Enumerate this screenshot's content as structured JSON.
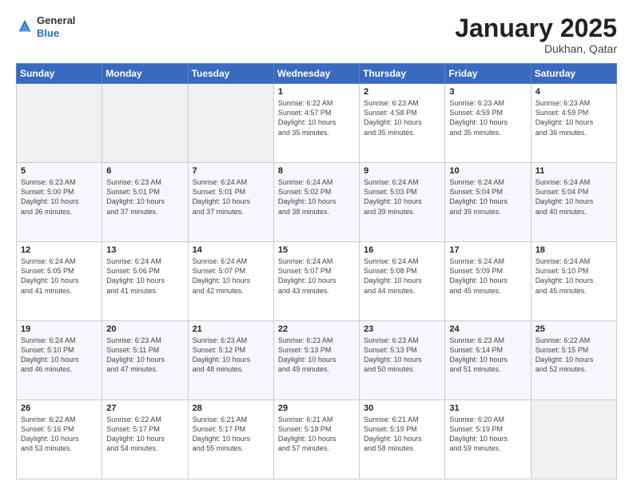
{
  "header": {
    "logo_general": "General",
    "logo_blue": "Blue",
    "month_title": "January 2025",
    "subtitle": "Dukhan, Qatar"
  },
  "days_of_week": [
    "Sunday",
    "Monday",
    "Tuesday",
    "Wednesday",
    "Thursday",
    "Friday",
    "Saturday"
  ],
  "weeks": [
    [
      {
        "num": "",
        "info": ""
      },
      {
        "num": "",
        "info": ""
      },
      {
        "num": "",
        "info": ""
      },
      {
        "num": "1",
        "info": "Sunrise: 6:22 AM\nSunset: 4:57 PM\nDaylight: 10 hours\nand 35 minutes."
      },
      {
        "num": "2",
        "info": "Sunrise: 6:23 AM\nSunset: 4:58 PM\nDaylight: 10 hours\nand 35 minutes."
      },
      {
        "num": "3",
        "info": "Sunrise: 6:23 AM\nSunset: 4:59 PM\nDaylight: 10 hours\nand 35 minutes."
      },
      {
        "num": "4",
        "info": "Sunrise: 6:23 AM\nSunset: 4:59 PM\nDaylight: 10 hours\nand 36 minutes."
      }
    ],
    [
      {
        "num": "5",
        "info": "Sunrise: 6:23 AM\nSunset: 5:00 PM\nDaylight: 10 hours\nand 36 minutes."
      },
      {
        "num": "6",
        "info": "Sunrise: 6:23 AM\nSunset: 5:01 PM\nDaylight: 10 hours\nand 37 minutes."
      },
      {
        "num": "7",
        "info": "Sunrise: 6:24 AM\nSunset: 5:01 PM\nDaylight: 10 hours\nand 37 minutes."
      },
      {
        "num": "8",
        "info": "Sunrise: 6:24 AM\nSunset: 5:02 PM\nDaylight: 10 hours\nand 38 minutes."
      },
      {
        "num": "9",
        "info": "Sunrise: 6:24 AM\nSunset: 5:03 PM\nDaylight: 10 hours\nand 39 minutes."
      },
      {
        "num": "10",
        "info": "Sunrise: 6:24 AM\nSunset: 5:04 PM\nDaylight: 10 hours\nand 39 minutes."
      },
      {
        "num": "11",
        "info": "Sunrise: 6:24 AM\nSunset: 5:04 PM\nDaylight: 10 hours\nand 40 minutes."
      }
    ],
    [
      {
        "num": "12",
        "info": "Sunrise: 6:24 AM\nSunset: 5:05 PM\nDaylight: 10 hours\nand 41 minutes."
      },
      {
        "num": "13",
        "info": "Sunrise: 6:24 AM\nSunset: 5:06 PM\nDaylight: 10 hours\nand 41 minutes."
      },
      {
        "num": "14",
        "info": "Sunrise: 6:24 AM\nSunset: 5:07 PM\nDaylight: 10 hours\nand 42 minutes."
      },
      {
        "num": "15",
        "info": "Sunrise: 6:24 AM\nSunset: 5:07 PM\nDaylight: 10 hours\nand 43 minutes."
      },
      {
        "num": "16",
        "info": "Sunrise: 6:24 AM\nSunset: 5:08 PM\nDaylight: 10 hours\nand 44 minutes."
      },
      {
        "num": "17",
        "info": "Sunrise: 6:24 AM\nSunset: 5:09 PM\nDaylight: 10 hours\nand 45 minutes."
      },
      {
        "num": "18",
        "info": "Sunrise: 6:24 AM\nSunset: 5:10 PM\nDaylight: 10 hours\nand 45 minutes."
      }
    ],
    [
      {
        "num": "19",
        "info": "Sunrise: 6:24 AM\nSunset: 5:10 PM\nDaylight: 10 hours\nand 46 minutes."
      },
      {
        "num": "20",
        "info": "Sunrise: 6:23 AM\nSunset: 5:11 PM\nDaylight: 10 hours\nand 47 minutes."
      },
      {
        "num": "21",
        "info": "Sunrise: 6:23 AM\nSunset: 5:12 PM\nDaylight: 10 hours\nand 48 minutes."
      },
      {
        "num": "22",
        "info": "Sunrise: 6:23 AM\nSunset: 5:13 PM\nDaylight: 10 hours\nand 49 minutes."
      },
      {
        "num": "23",
        "info": "Sunrise: 6:23 AM\nSunset: 5:13 PM\nDaylight: 10 hours\nand 50 minutes."
      },
      {
        "num": "24",
        "info": "Sunrise: 6:23 AM\nSunset: 5:14 PM\nDaylight: 10 hours\nand 51 minutes."
      },
      {
        "num": "25",
        "info": "Sunrise: 6:22 AM\nSunset: 5:15 PM\nDaylight: 10 hours\nand 52 minutes."
      }
    ],
    [
      {
        "num": "26",
        "info": "Sunrise: 6:22 AM\nSunset: 5:16 PM\nDaylight: 10 hours\nand 53 minutes."
      },
      {
        "num": "27",
        "info": "Sunrise: 6:22 AM\nSunset: 5:17 PM\nDaylight: 10 hours\nand 54 minutes."
      },
      {
        "num": "28",
        "info": "Sunrise: 6:21 AM\nSunset: 5:17 PM\nDaylight: 10 hours\nand 55 minutes."
      },
      {
        "num": "29",
        "info": "Sunrise: 6:21 AM\nSunset: 5:18 PM\nDaylight: 10 hours\nand 57 minutes."
      },
      {
        "num": "30",
        "info": "Sunrise: 6:21 AM\nSunset: 5:19 PM\nDaylight: 10 hours\nand 58 minutes."
      },
      {
        "num": "31",
        "info": "Sunrise: 6:20 AM\nSunset: 5:19 PM\nDaylight: 10 hours\nand 59 minutes."
      },
      {
        "num": "",
        "info": ""
      }
    ]
  ]
}
